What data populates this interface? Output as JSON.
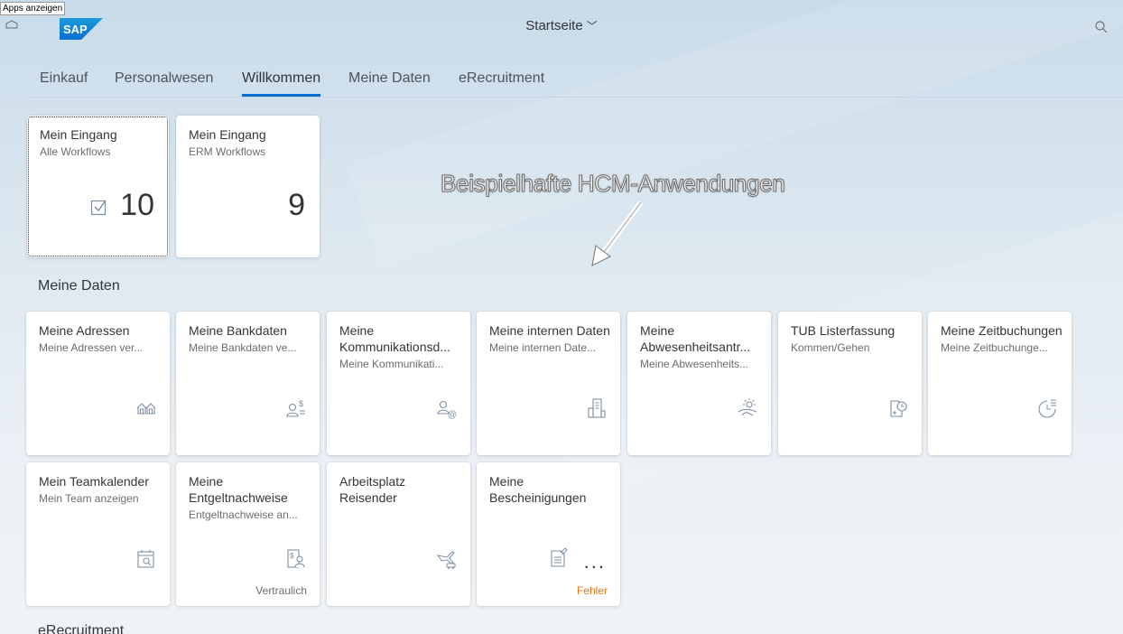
{
  "shell": {
    "tooltip": "Apps anzeigen",
    "logo_text": "SAP",
    "title": "Startseite",
    "brand_color": "#0a6ed1"
  },
  "tabs": [
    {
      "label": "Einkauf",
      "active": false
    },
    {
      "label": "Personalwesen",
      "active": false
    },
    {
      "label": "Willkommen",
      "active": true
    },
    {
      "label": "Meine Daten",
      "active": false
    },
    {
      "label": "eRecruitment",
      "active": false
    }
  ],
  "welcome_tiles": [
    {
      "title": "Mein Eingang",
      "subtitle": "Alle Workflows",
      "number": "10",
      "icon": "checkbox-icon"
    },
    {
      "title": "Mein Eingang",
      "subtitle": "ERM Workflows",
      "number": "9"
    }
  ],
  "annotation": "Beispielhafte HCM-Anwendungen",
  "sections": {
    "meine_daten": "Meine Daten",
    "erecruitment": "eRecruitment"
  },
  "meine_daten_tiles": [
    {
      "title": "Meine Adressen",
      "subtitle": "Meine Adressen ver...",
      "icon": "addresses-icon"
    },
    {
      "title": "Meine Bankdaten",
      "subtitle": "Meine Bankdaten ve...",
      "icon": "bank-person-icon"
    },
    {
      "title": "Meine Kommunikationsd...",
      "subtitle": "Meine Kommunikati...",
      "icon": "person-email-icon"
    },
    {
      "title": "Meine internen Daten",
      "subtitle": "Meine internen Date...",
      "icon": "building-icon"
    },
    {
      "title": "Meine Abwesenheitsantr...",
      "subtitle": "Meine Abwesenheits...",
      "icon": "vacation-icon"
    },
    {
      "title": "TUB Listerfassung",
      "subtitle": "Kommen/Gehen",
      "icon": "time-entry-icon"
    },
    {
      "title": "Meine Zeitbuchungen",
      "subtitle": "Meine Zeitbuchunge...",
      "icon": "time-list-icon"
    }
  ],
  "row2_tiles": [
    {
      "title": "Mein Teamkalender",
      "subtitle": "Mein Team anzeigen",
      "icon": "calendar-search-icon",
      "footer": ""
    },
    {
      "title": "Meine Entgeltnachweise",
      "subtitle": "Entgeltnachweise an...",
      "icon": "payslip-icon",
      "footer": "Vertraulich"
    },
    {
      "title": "Arbeitsplatz Reisender",
      "subtitle": "",
      "icon": "travel-icon",
      "footer": ""
    },
    {
      "title": "Meine Bescheinigungen",
      "subtitle": "",
      "icon": "certificate-icon",
      "footer": "Fehler",
      "dots": "..."
    }
  ]
}
